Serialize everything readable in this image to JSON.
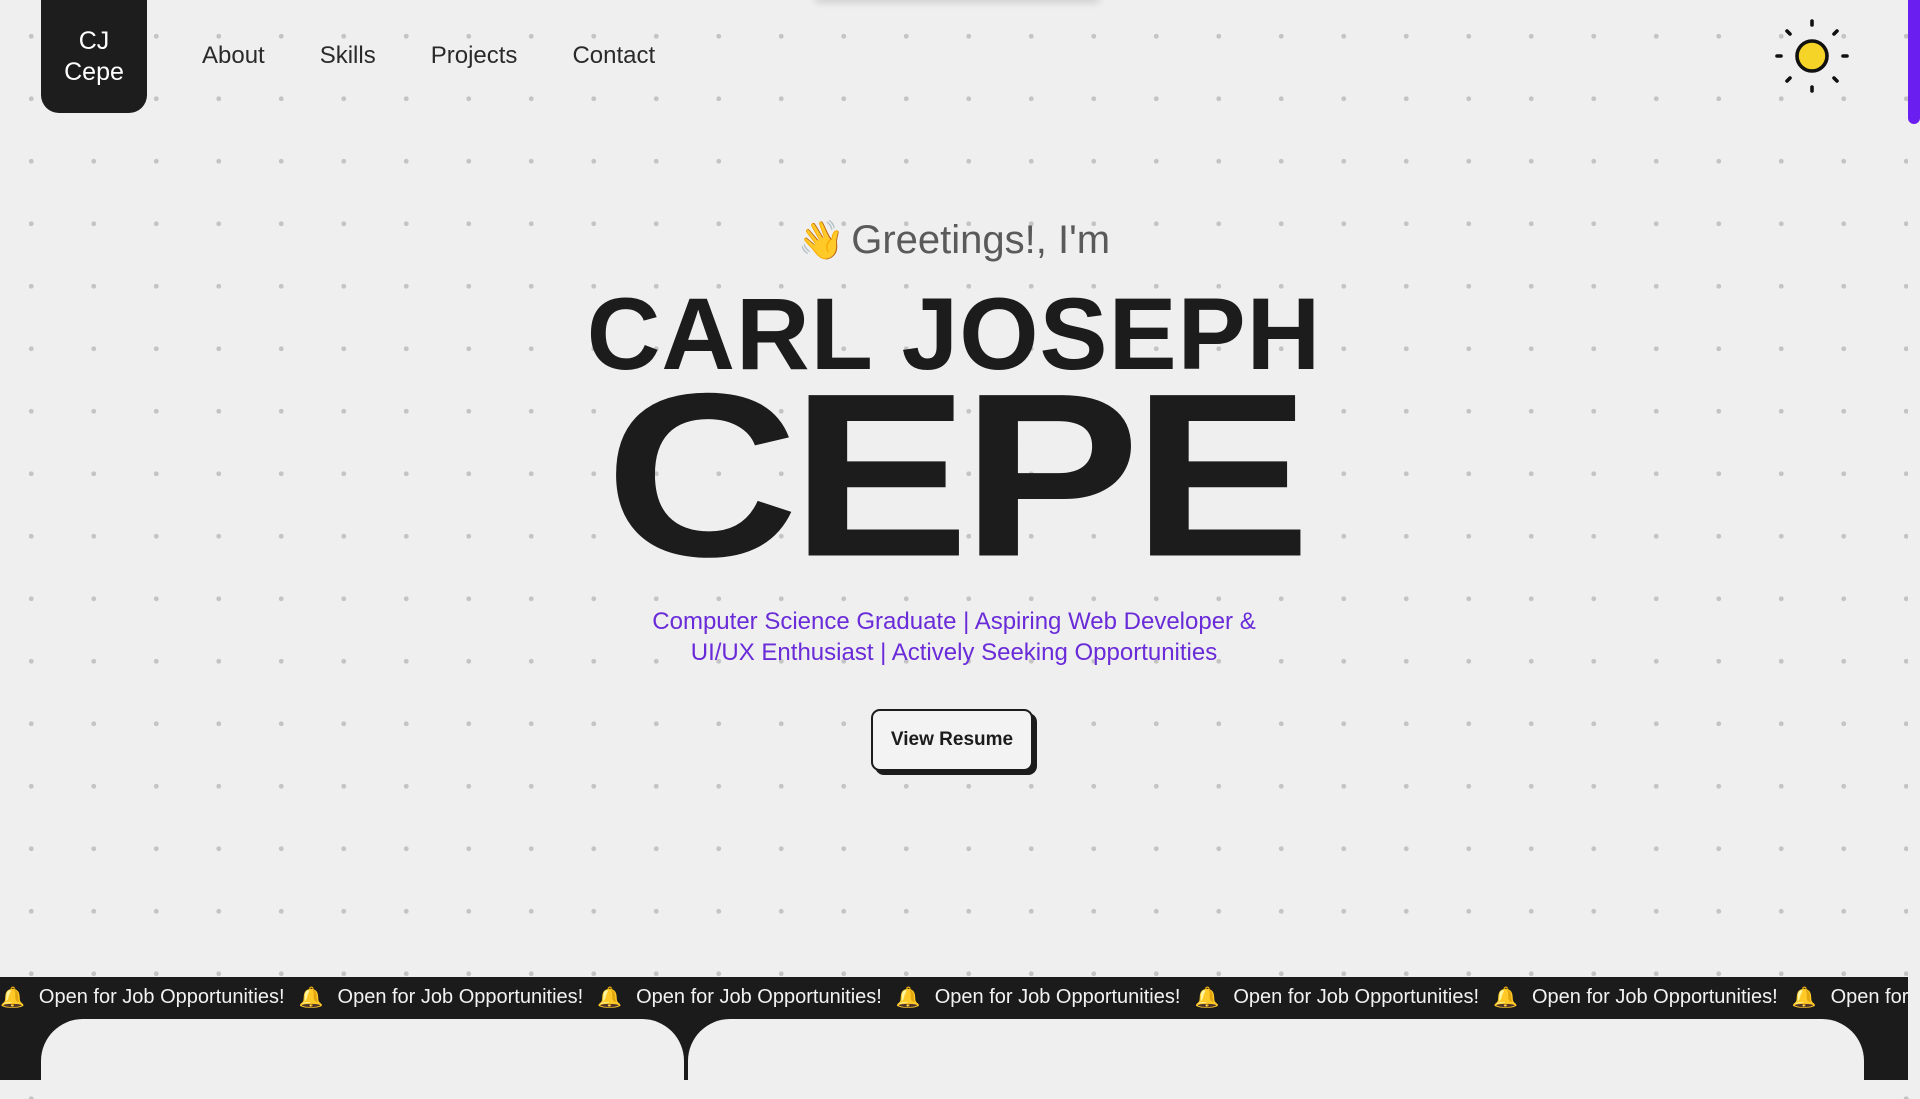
{
  "header": {
    "logo_line1": "CJ",
    "logo_line2": "Cepe",
    "nav": [
      "About",
      "Skills",
      "Projects",
      "Contact"
    ],
    "theme_icon": "sun-icon"
  },
  "hero": {
    "greeting": "Greetings!, I'm",
    "wave_emoji": "👋",
    "first_name": "CARL JOSEPH",
    "last_name": "CEPE",
    "tagline_line1": "Computer Science Graduate | Aspiring Web Developer &",
    "tagline_line2": "UI/UX Enthusiast | Actively Seeking Opportunities",
    "resume_label": "View Resume"
  },
  "marquee": {
    "text": "Open for Job Opportunities!",
    "icon": "🔔",
    "icon_name": "bell-icon"
  },
  "colors": {
    "background": "#efefef",
    "dark": "#1c1c1c",
    "accent": "#6a2bd8",
    "sun": "#f5d327",
    "scrollbar": "#6a1ef0"
  }
}
